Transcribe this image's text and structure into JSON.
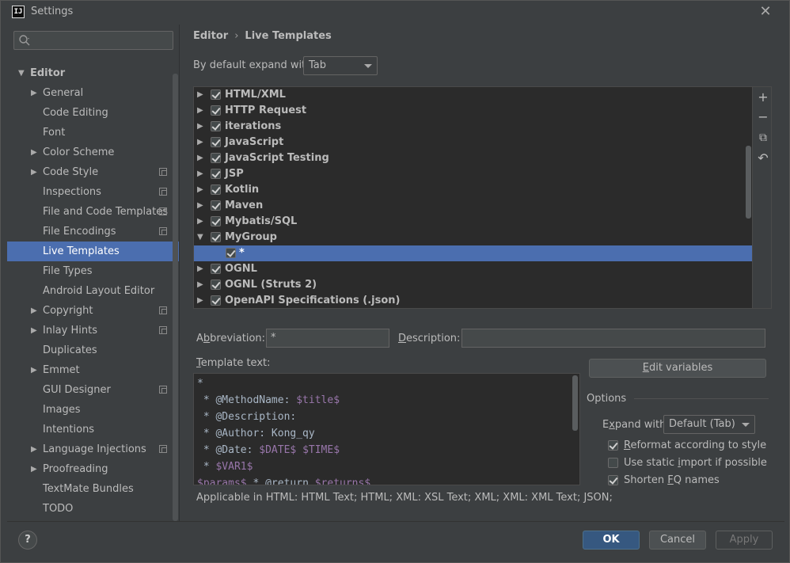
{
  "window": {
    "title": "Settings"
  },
  "sidebar": {
    "search_placeholder": "",
    "items": [
      {
        "label": "Editor",
        "level": 0,
        "expanded": true,
        "has_arrow": true
      },
      {
        "label": "General",
        "level": 1,
        "has_arrow": true
      },
      {
        "label": "Code Editing",
        "level": 1
      },
      {
        "label": "Font",
        "level": 1
      },
      {
        "label": "Color Scheme",
        "level": 1,
        "has_arrow": true
      },
      {
        "label": "Code Style",
        "level": 1,
        "has_arrow": true,
        "copy": true
      },
      {
        "label": "Inspections",
        "level": 1,
        "copy": true
      },
      {
        "label": "File and Code Templates",
        "level": 1,
        "copy": true
      },
      {
        "label": "File Encodings",
        "level": 1,
        "copy": true
      },
      {
        "label": "Live Templates",
        "level": 1,
        "selected": true
      },
      {
        "label": "File Types",
        "level": 1
      },
      {
        "label": "Android Layout Editor",
        "level": 1
      },
      {
        "label": "Copyright",
        "level": 1,
        "has_arrow": true,
        "copy": true
      },
      {
        "label": "Inlay Hints",
        "level": 1,
        "has_arrow": true,
        "copy": true
      },
      {
        "label": "Duplicates",
        "level": 1
      },
      {
        "label": "Emmet",
        "level": 1,
        "has_arrow": true
      },
      {
        "label": "GUI Designer",
        "level": 1,
        "copy": true
      },
      {
        "label": "Images",
        "level": 1
      },
      {
        "label": "Intentions",
        "level": 1
      },
      {
        "label": "Language Injections",
        "level": 1,
        "has_arrow": true,
        "copy": true
      },
      {
        "label": "Proofreading",
        "level": 1,
        "has_arrow": true
      },
      {
        "label": "TextMate Bundles",
        "level": 1
      },
      {
        "label": "TODO",
        "level": 1
      }
    ]
  },
  "breadcrumb": {
    "parent": "Editor",
    "separator": "›",
    "current": "Live Templates"
  },
  "expand": {
    "label": "By default expand with",
    "value": "Tab"
  },
  "templates": [
    {
      "name": "HTML/XML",
      "checked": true,
      "arrow": "▶"
    },
    {
      "name": "HTTP Request",
      "checked": true,
      "arrow": "▶"
    },
    {
      "name": "iterations",
      "checked": true,
      "arrow": "▶"
    },
    {
      "name": "JavaScript",
      "checked": true,
      "arrow": "▶"
    },
    {
      "name": "JavaScript Testing",
      "checked": true,
      "arrow": "▶"
    },
    {
      "name": "JSP",
      "checked": true,
      "arrow": "▶"
    },
    {
      "name": "Kotlin",
      "checked": true,
      "arrow": "▶"
    },
    {
      "name": "Maven",
      "checked": true,
      "arrow": "▶"
    },
    {
      "name": "Mybatis/SQL",
      "checked": true,
      "arrow": "▶"
    },
    {
      "name": "MyGroup",
      "checked": true,
      "arrow": "▼"
    },
    {
      "name": "*",
      "checked": true,
      "arrow": "",
      "child": true,
      "selected": true
    },
    {
      "name": "OGNL",
      "checked": true,
      "arrow": "▶"
    },
    {
      "name": "OGNL (Struts 2)",
      "checked": true,
      "arrow": "▶"
    },
    {
      "name": "OpenAPI Specifications (.json)",
      "checked": true,
      "arrow": "▶"
    }
  ],
  "toolbar": {
    "add": "+",
    "remove": "−",
    "copy": "⧉",
    "restore": "↶"
  },
  "abbreviation": {
    "label_pre": "A",
    "label_u": "b",
    "label_post": "breviation:",
    "value": "*"
  },
  "description": {
    "label_u": "D",
    "label_post": "escription:",
    "value": ""
  },
  "template_text": {
    "label_u": "T",
    "label_post": "emplate text:",
    "lines": [
      [
        {
          "t": "*"
        }
      ],
      [
        {
          "t": " * @MethodName: "
        },
        {
          "t": "$title$",
          "v": true
        }
      ],
      [
        {
          "t": " * @Description:"
        }
      ],
      [
        {
          "t": " * @Author: Kong_qy"
        }
      ],
      [
        {
          "t": " * @Date: "
        },
        {
          "t": "$DATE$",
          "v": true
        },
        {
          "t": " "
        },
        {
          "t": "$TIME$",
          "v": true
        }
      ],
      [
        {
          "t": " * "
        },
        {
          "t": "$VAR1$",
          "v": true
        }
      ],
      [
        {
          "t": "$params$",
          "v": true
        },
        {
          "t": " * @return "
        },
        {
          "t": "$returns$",
          "v": true
        }
      ]
    ]
  },
  "edit_variables": {
    "label_u": "E",
    "label_post": "dit variables"
  },
  "options": {
    "title": "Options",
    "expand_label_u": "x",
    "expand_label_pre": "E",
    "expand_label_post": "pand with",
    "expand_value": "Default (Tab)",
    "checks": [
      {
        "pre": "",
        "u": "R",
        "post": "eformat according to style",
        "checked": true
      },
      {
        "pre": "Use static ",
        "u": "i",
        "post": "mport if possible",
        "checked": false
      },
      {
        "pre": "Shorten ",
        "u": "F",
        "post": "Q names",
        "checked": true
      }
    ]
  },
  "applicable": "Applicable in HTML: HTML Text; HTML; XML: XSL Text; XML; XML: XML Text; JSON;",
  "buttons": {
    "help": "?",
    "ok": "OK",
    "cancel": "Cancel",
    "apply": "Apply"
  }
}
